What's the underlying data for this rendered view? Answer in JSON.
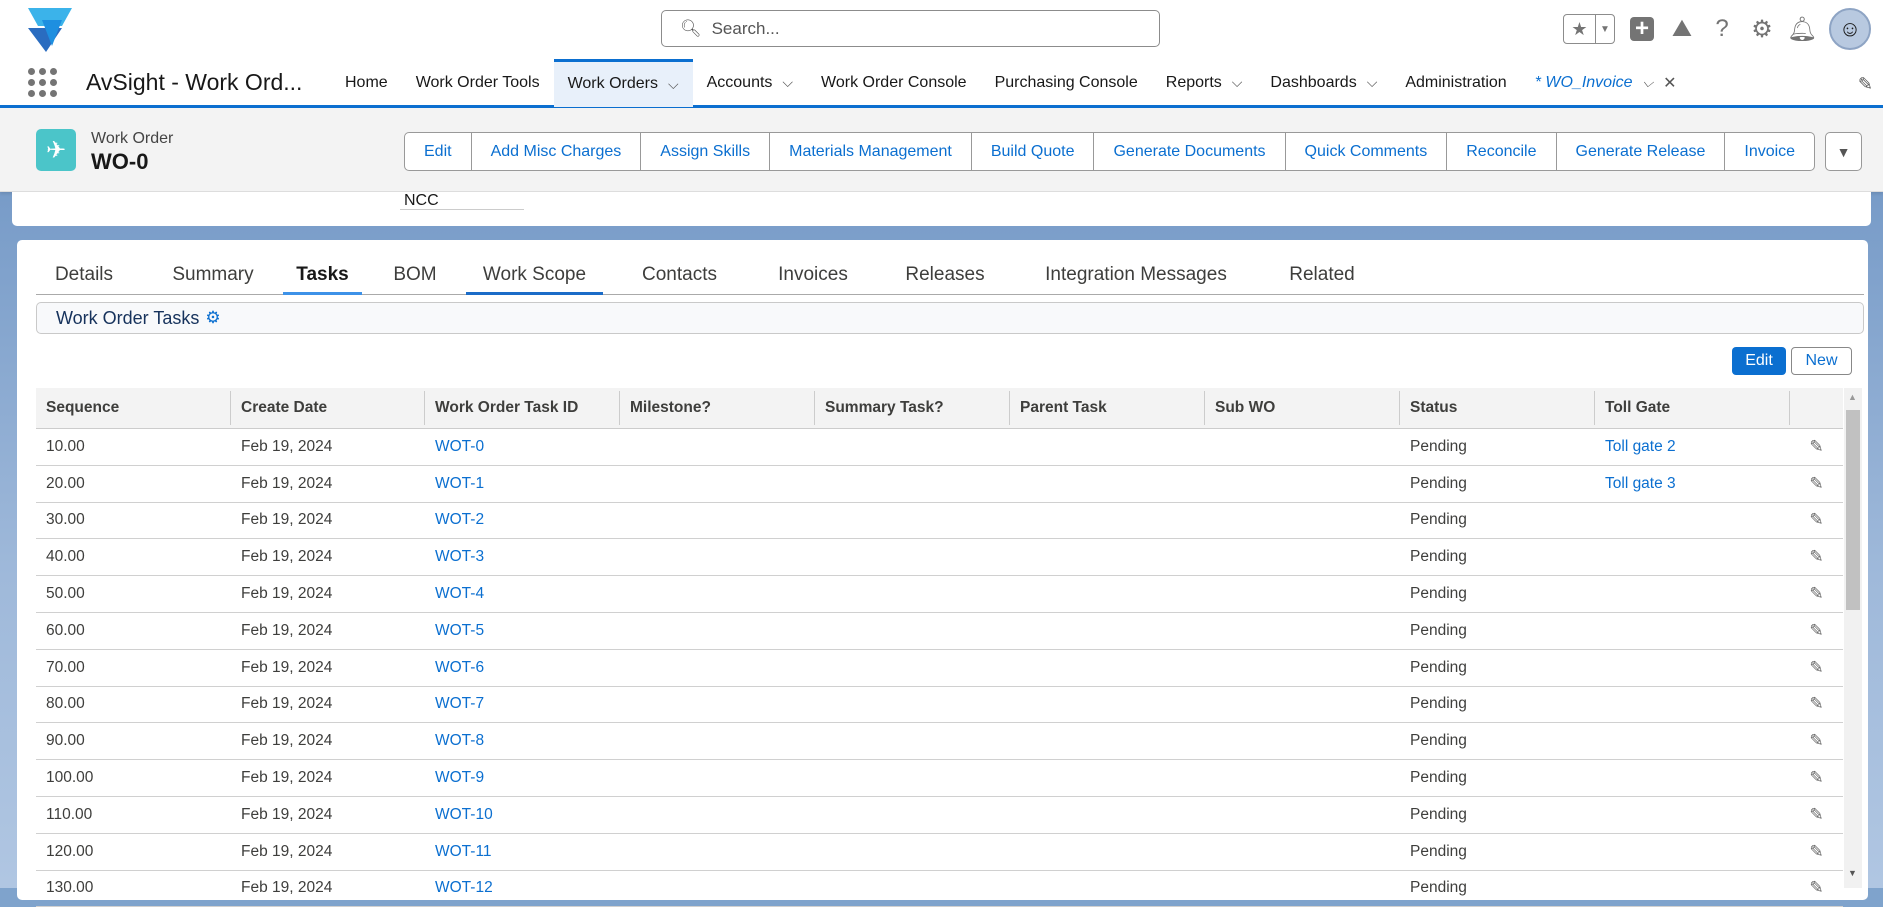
{
  "search": {
    "placeholder": "Search..."
  },
  "nav": {
    "app_name": "AvSight - Work Ord...",
    "items": [
      {
        "label": "Home",
        "dropdown": false
      },
      {
        "label": "Work Order Tools",
        "dropdown": false
      },
      {
        "label": "Work Orders",
        "dropdown": true,
        "active": true
      },
      {
        "label": "Accounts",
        "dropdown": true
      },
      {
        "label": "Work Order Console",
        "dropdown": false
      },
      {
        "label": "Purchasing Console",
        "dropdown": false
      },
      {
        "label": "Reports",
        "dropdown": true
      },
      {
        "label": "Dashboards",
        "dropdown": true
      },
      {
        "label": "Administration",
        "dropdown": false
      }
    ],
    "open_tab": "* WO_Invoice"
  },
  "record": {
    "type": "Work Order",
    "name": "WO-0",
    "ncc_value": "NCC",
    "actions": [
      "Edit",
      "Add Misc Charges",
      "Assign Skills",
      "Materials Management",
      "Build Quote",
      "Generate Documents",
      "Quick Comments",
      "Reconcile",
      "Generate Release",
      "Invoice"
    ]
  },
  "tabs": [
    "Details",
    "Summary",
    "Tasks",
    "BOM",
    "Work Scope",
    "Contacts",
    "Invoices",
    "Releases",
    "Integration Messages",
    "Related"
  ],
  "active_tab": "Tasks",
  "section": {
    "title": "Work Order Tasks",
    "edit_label": "Edit",
    "new_label": "New"
  },
  "table": {
    "columns": [
      "Sequence",
      "Create Date",
      "Work Order Task ID",
      "Milestone?",
      "Summary Task?",
      "Parent Task",
      "Sub WO",
      "Status",
      "Toll Gate"
    ],
    "rows": [
      {
        "seq": "10.00",
        "date": "Feb 19, 2024",
        "id": "WOT-0",
        "status": "Pending",
        "toll": "Toll gate 2"
      },
      {
        "seq": "20.00",
        "date": "Feb 19, 2024",
        "id": "WOT-1",
        "status": "Pending",
        "toll": "Toll gate 3"
      },
      {
        "seq": "30.00",
        "date": "Feb 19, 2024",
        "id": "WOT-2",
        "status": "Pending",
        "toll": ""
      },
      {
        "seq": "40.00",
        "date": "Feb 19, 2024",
        "id": "WOT-3",
        "status": "Pending",
        "toll": ""
      },
      {
        "seq": "50.00",
        "date": "Feb 19, 2024",
        "id": "WOT-4",
        "status": "Pending",
        "toll": ""
      },
      {
        "seq": "60.00",
        "date": "Feb 19, 2024",
        "id": "WOT-5",
        "status": "Pending",
        "toll": ""
      },
      {
        "seq": "70.00",
        "date": "Feb 19, 2024",
        "id": "WOT-6",
        "status": "Pending",
        "toll": ""
      },
      {
        "seq": "80.00",
        "date": "Feb 19, 2024",
        "id": "WOT-7",
        "status": "Pending",
        "toll": ""
      },
      {
        "seq": "90.00",
        "date": "Feb 19, 2024",
        "id": "WOT-8",
        "status": "Pending",
        "toll": ""
      },
      {
        "seq": "100.00",
        "date": "Feb 19, 2024",
        "id": "WOT-9",
        "status": "Pending",
        "toll": ""
      },
      {
        "seq": "110.00",
        "date": "Feb 19, 2024",
        "id": "WOT-10",
        "status": "Pending",
        "toll": ""
      },
      {
        "seq": "120.00",
        "date": "Feb 19, 2024",
        "id": "WOT-11",
        "status": "Pending",
        "toll": ""
      },
      {
        "seq": "130.00",
        "date": "Feb 19, 2024",
        "id": "WOT-12",
        "status": "Pending",
        "toll": ""
      }
    ]
  },
  "colors": {
    "brand": "#0b6fd0",
    "header_bg": "#f3f3f3",
    "record_icon": "#4bc5c9"
  }
}
